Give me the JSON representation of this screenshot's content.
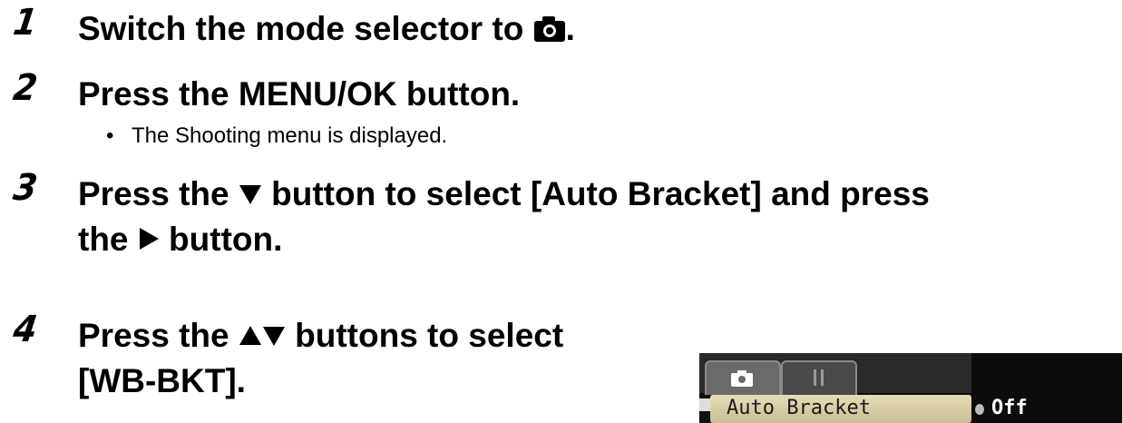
{
  "steps": [
    {
      "number": "1",
      "title_before": "Switch the mode selector to ",
      "title_icon": "camera-icon",
      "title_after": "."
    },
    {
      "number": "2",
      "title": "Press the MENU/OK button.",
      "bullet": "The Shooting menu is displayed."
    },
    {
      "number": "3",
      "line1_before": "Press the ",
      "line1_icon": "down-triangle-icon",
      "line1_after": " button to select [Auto Bracket] and press",
      "line2_before": "the ",
      "line2_icon": "right-triangle-icon",
      "line2_after": " button."
    },
    {
      "number": "4",
      "line1_before": "Press the ",
      "line1_icon": "up-down-triangles-icon",
      "line1_after": " buttons to select",
      "line2": "[WB-BKT]."
    }
  ],
  "lcd": {
    "tab_camera_icon": "camera-icon",
    "tab_setup_icon": "wrench-icon",
    "menu_item_label": "Auto Bracket",
    "menu_item_value": "Off",
    "highlight_color": "#e6dcb6"
  }
}
